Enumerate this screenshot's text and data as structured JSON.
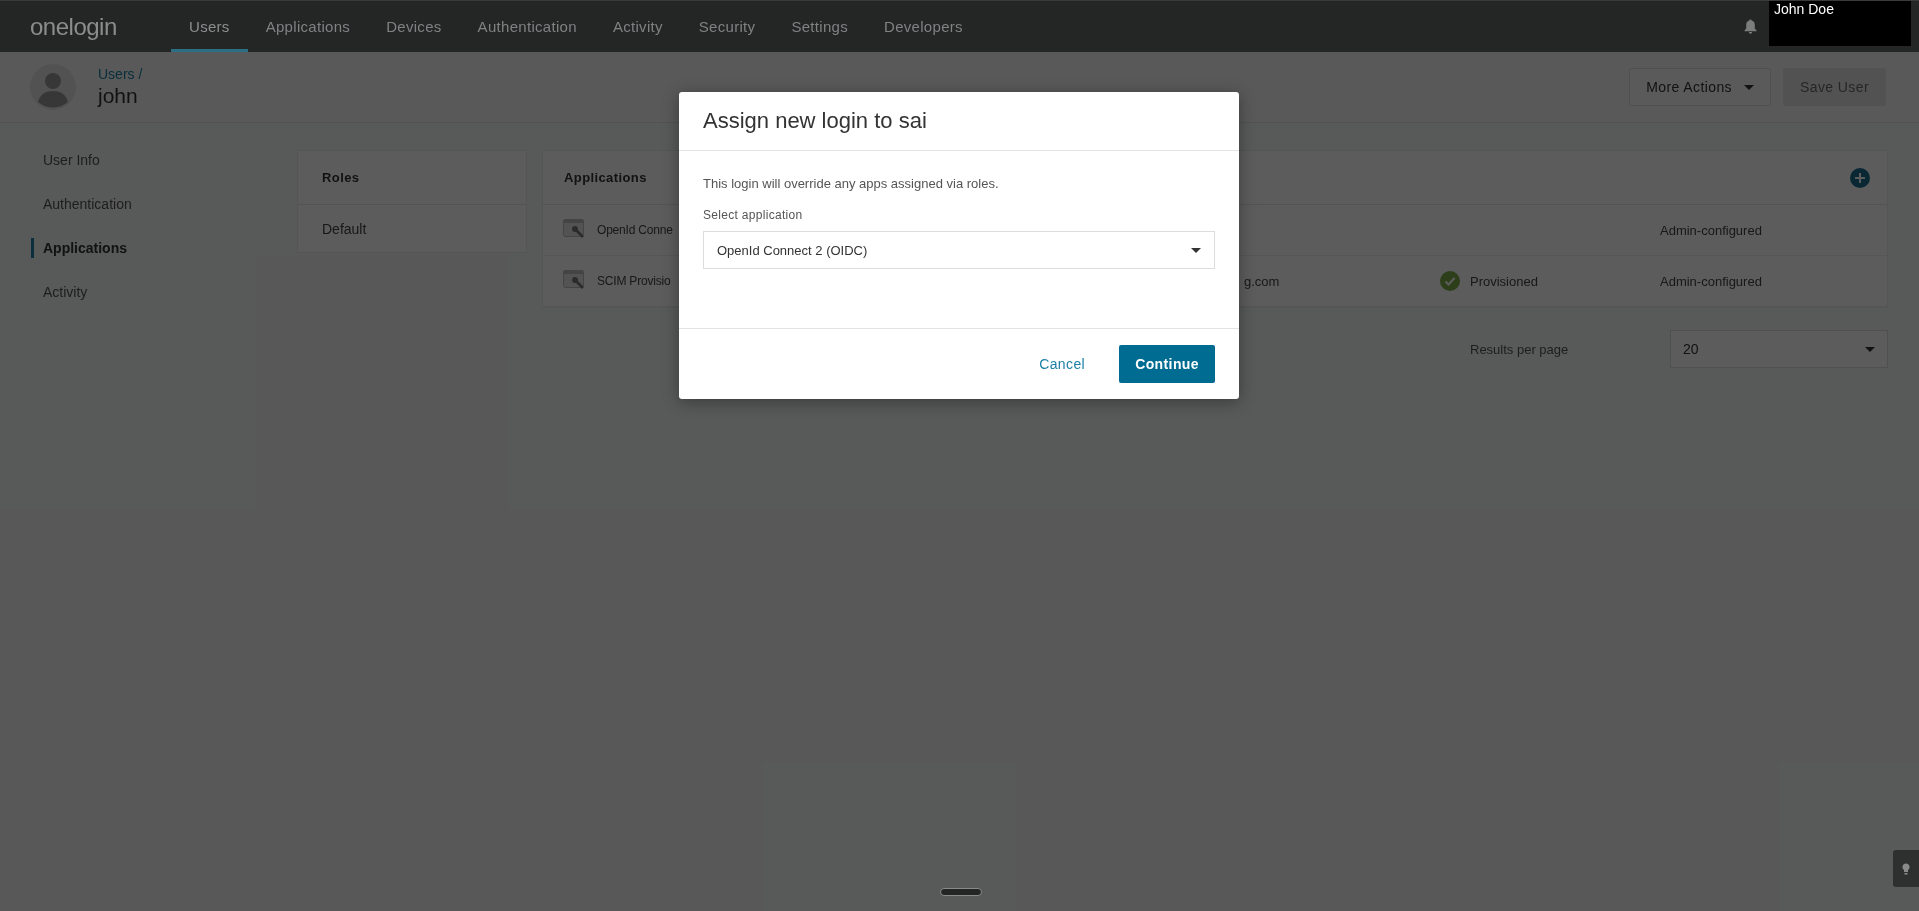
{
  "nav": {
    "logo": "onelogin",
    "items": [
      {
        "label": "Users",
        "selected": true
      },
      {
        "label": "Applications",
        "selected": false
      },
      {
        "label": "Devices",
        "selected": false
      },
      {
        "label": "Authentication",
        "selected": false
      },
      {
        "label": "Activity",
        "selected": false
      },
      {
        "label": "Security",
        "selected": false
      },
      {
        "label": "Settings",
        "selected": false
      },
      {
        "label": "Developers",
        "selected": false
      }
    ],
    "user_name": "John Doe"
  },
  "user_header": {
    "breadcrumb": "Users /",
    "name": "john",
    "buttons": [
      {
        "label": "More Actions",
        "kind": "dropdown",
        "disabled": false
      },
      {
        "label": "Save User",
        "kind": "primary",
        "disabled": true
      }
    ]
  },
  "sidebar": {
    "items": [
      {
        "label": "User Info",
        "selected": false
      },
      {
        "label": "Authentication",
        "selected": false
      },
      {
        "label": "Applications",
        "selected": true
      },
      {
        "label": "Activity",
        "selected": false
      }
    ]
  },
  "roles": {
    "title": "Roles",
    "rows": [
      "Default"
    ]
  },
  "applications": {
    "title": "Applications",
    "rows": [
      {
        "name": "OpenId Conne",
        "type": "Admin-configured"
      },
      {
        "name": "SCIM Provisio",
        "column_2": "g.com",
        "status": "Provisioned",
        "type": "Admin-configured"
      }
    ]
  },
  "pagination": {
    "label": "Results per page",
    "value": "20"
  },
  "modal": {
    "title": "Assign new login to sai",
    "message": "This login will override any apps assigned via roles.",
    "field_label": "Select application",
    "field_value": "OpenId Connect 2 (OIDC)",
    "buttons": [
      {
        "label": "Cancel",
        "kind": "link"
      },
      {
        "label": "Continue",
        "kind": "primary"
      }
    ]
  }
}
